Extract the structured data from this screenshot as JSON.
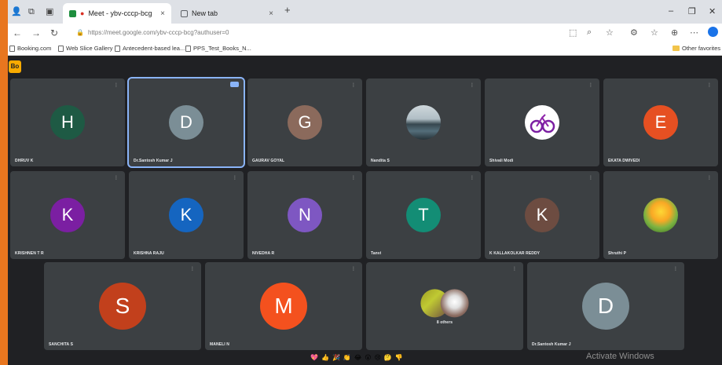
{
  "browser": {
    "tabs": [
      {
        "title": "Meet - ybv-cccp-bcg",
        "active": true,
        "favicon_color": "#1e8e3e"
      },
      {
        "title": "New tab",
        "active": false,
        "favicon_color": "#5f6368"
      }
    ],
    "tab_close_glyph": "×",
    "new_tab_glyph": "+",
    "url": "https://meet.google.com/ybv-cccp-bcg?authuser=0",
    "bookmarks": [
      {
        "label": "Booking.com"
      },
      {
        "label": "Web Slice Gallery"
      },
      {
        "label": "Antecedent-based lea..."
      },
      {
        "label": "PPS_Test_Books_N..."
      }
    ],
    "other_favorites": "Other favorites",
    "window_controls": {
      "minimize": "–",
      "restore": "❐",
      "close": "✕"
    }
  },
  "meet": {
    "badge": "Bo",
    "participants": [
      {
        "initial": "H",
        "name": "DHRUV K",
        "color": "#1e5a44",
        "row": 0
      },
      {
        "initial": "D",
        "name": "Dr.Santosh Kumar J",
        "color": "#7b8e96",
        "row": 0,
        "active": true
      },
      {
        "initial": "G",
        "name": "GAURAV GOYAL",
        "color": "#8b6a5c",
        "row": 0
      },
      {
        "photo": "landscape-photo",
        "name": "Nandita S",
        "row": 0
      },
      {
        "photo": "bicycle-photo",
        "name": "Shivali Modi",
        "row": 0
      },
      {
        "initial": "E",
        "name": "EKATA DWIVEDI",
        "color": "#e65022",
        "row": 0
      },
      {
        "initial": "K",
        "name": "KRISHNEN T R",
        "color": "#7b1fa2",
        "row": 1
      },
      {
        "initial": "K",
        "name": "KRISHNA RAJU",
        "color": "#1565c0",
        "row": 1
      },
      {
        "initial": "N",
        "name": "NIVEDHA R",
        "color": "#7e57c2",
        "row": 1
      },
      {
        "initial": "T",
        "name": "Tanvi",
        "color": "#138d75",
        "row": 1
      },
      {
        "initial": "K",
        "name": "K KALLAKOLKAR REDDY",
        "color": "#6d4c41",
        "row": 1
      },
      {
        "photo": "cartoon-photo",
        "name": "Shruthi P",
        "row": 1
      },
      {
        "initial": "S",
        "name": "SANCHITA S",
        "color": "#c2401c",
        "row": 2
      },
      {
        "initial": "M",
        "name": "MANELI N",
        "color": "#f4511e",
        "row": 2
      },
      {
        "photo": "group-photos",
        "name": "8 others",
        "row": 2
      },
      {
        "initial": "D",
        "name": "Dr.Santosh Kumar J",
        "color": "#7b8e96",
        "row": 2
      }
    ],
    "reactions": [
      "💖",
      "👍",
      "🎉",
      "👏",
      "😂",
      "😮",
      "😢",
      "🤔",
      "👎"
    ],
    "watermark": "Activate Windows"
  }
}
